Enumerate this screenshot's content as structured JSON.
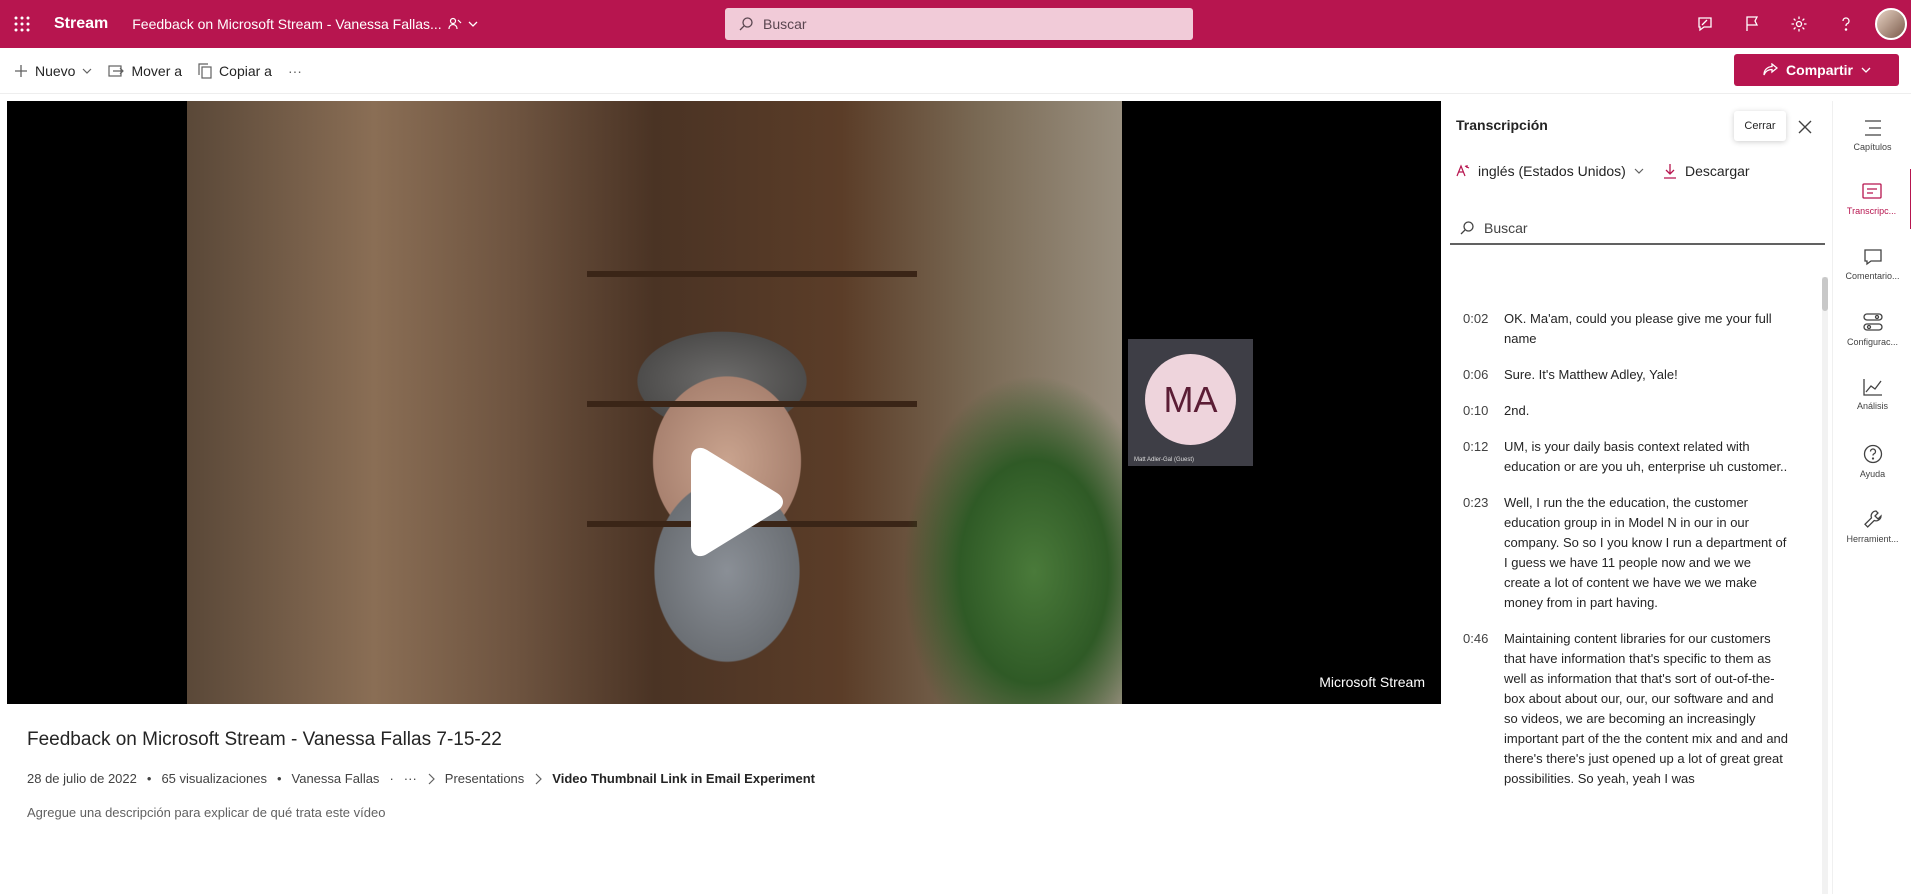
{
  "header": {
    "app_name": "Stream",
    "doc_title": "Feedback on Microsoft Stream - Vanessa Fallas...",
    "search_placeholder": "Buscar",
    "icons": [
      "feedback-icon",
      "flag-icon",
      "gear-icon",
      "help-icon",
      "avatar"
    ]
  },
  "commandbar": {
    "new_label": "Nuevo",
    "move_label": "Mover a",
    "copy_label": "Copiar a",
    "more_label": "···",
    "share_label": "Compartir"
  },
  "video": {
    "watermark": "Microsoft Stream",
    "participant_initials": "MA",
    "participant_name": "Matt Adler-Gal (Guest)"
  },
  "details": {
    "title": "Feedback on Microsoft Stream - Vanessa Fallas 7-15-22",
    "date": "28 de julio de 2022",
    "views": "65 visualizaciones",
    "author": "Vanessa Fallas",
    "dot": "·",
    "more": "···",
    "breadcrumb_1": "Presentations",
    "breadcrumb_2": "Video Thumbnail Link in Email Experiment",
    "description_placeholder": "Agregue una descripción para explicar de qué trata este vídeo"
  },
  "transcript": {
    "title": "Transcripción",
    "close_tooltip": "Cerrar",
    "language": "inglés (Estados Unidos)",
    "download": "Descargar",
    "search_placeholder": "Buscar",
    "entries": [
      {
        "time": "0:02",
        "text": "OK. Ma'am, could you please give me your full name"
      },
      {
        "time": "0:06",
        "text": "Sure. It's Matthew Adley, Yale!"
      },
      {
        "time": "0:10",
        "text": "2nd."
      },
      {
        "time": "0:12",
        "text": "UM, is your daily basis context related with education or are you uh, enterprise uh customer.."
      },
      {
        "time": "0:23",
        "text": "Well, I run the the education, the customer education group in in Model N in our in our company. So so I you know I run a department of I guess we have 11 people now and we we create a lot of content we have we we make money from in part having."
      },
      {
        "time": "0:46",
        "text": "Maintaining content libraries for our customers that have information that's specific to them as well as information that that's sort of out-of-the-box about about our, our, our software and and so videos, we are becoming an increasingly important part of the the content mix and and and there's there's just opened up a lot of great great possibilities. So yeah, yeah I was"
      }
    ]
  },
  "rail": [
    {
      "label": "Capítulos",
      "icon": "chapters-icon"
    },
    {
      "label": "Transcripc...",
      "icon": "transcript-icon"
    },
    {
      "label": "Comentario...",
      "icon": "comment-icon"
    },
    {
      "label": "Configurac...",
      "icon": "settings-toggle-icon"
    },
    {
      "label": "Análisis",
      "icon": "analytics-icon"
    },
    {
      "label": "Ayuda",
      "icon": "help-icon"
    },
    {
      "label": "Herramient...",
      "icon": "wrench-icon"
    }
  ],
  "colors": {
    "brand": "#b7154f",
    "search_bg": "#f1cbd8"
  }
}
